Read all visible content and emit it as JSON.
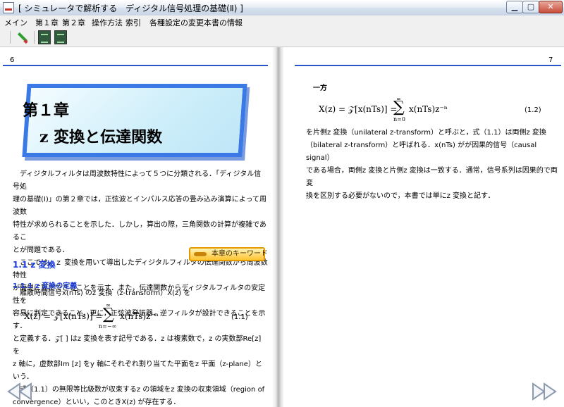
{
  "window": {
    "title": "[ シミュレータで解析する　ディジタル信号処理の基礎(Ⅱ) ]"
  },
  "menu": [
    "メイン",
    "第１章",
    "第２章",
    "操作方法",
    "索引",
    "各種設定の変更",
    "本書の情報"
  ],
  "toolbar": {
    "icons": [
      "pen-icon",
      "screen-icon",
      "screen-icon"
    ]
  },
  "left_page": {
    "page_number": "6",
    "chapter_title": "第１章",
    "chapter_subtitle": "z 変換と伝達関数",
    "intro": [
      "　ディジタルフィルタは周波数特性によって５つに分類される．「ディジタル信号処",
      "理の基礎(Ⅰ)」の第２章では，正弦波とインパルス応答の畳み込み演算によって周波数",
      "特性が求められることを示した．しかし，算出の際，三角関数の計算が複雑であるこ",
      "とが問題である．",
      "　ここでは，ｚ 変換を用いて導出したディジタルフィルタの伝達関数から周波数特性",
      "が簡単に算出できることを示す．また，伝達関数からディジタルフィルタの安定性を",
      "容易に判定できること，更に，正弦波発振器，逆フィルタが設計できることを示す．"
    ],
    "keyword_button": "本章のキーワード",
    "section_heading": "1.1 z 変換",
    "subsection_heading": "1.1.1 z 変換の定義",
    "def_line": "　離散時間信号x(nTs) のz 変換（z-transform）X(z) を",
    "eq1_lhs": "X(z) = 𝒵[x(nTs)] =",
    "eq1_sum_top": "∞",
    "eq1_sum_bottom": "n=−∞",
    "eq1_rhs": "x(nTs)z⁻ⁿ",
    "eq1_number": "(1.1)",
    "after": [
      "と定義する．𝒵[ ] はz 変換を表す記号である．z は複素数で，z の実数部Re[z] を",
      "z 軸に，虚数部Im [z] をy 軸にそれぞれ割り当てた平面をz 平面（z-plane）という．",
      "　式（1.1）の無限等比級数が収束するz の領域をz 変換の収束領域（region of",
      "convergence）といい，このときX(z) が存在する．"
    ]
  },
  "right_page": {
    "page_number": "7",
    "intro_word": "一方",
    "eq2_lhs": "X(z) = 𝒵[x(nTs)] =",
    "eq2_sum_top": "∞",
    "eq2_sum_bottom": "n=0",
    "eq2_rhs": "x(nTs)z⁻ⁿ",
    "eq2_number": "(1.2)",
    "body": [
      "を片側z 変換（unilateral z-transform）と呼ぶと，式（1.1）は両側z 変換",
      "（bilateral z-transform）と呼ばれる．x(nTs) がが因果的信号（causal signal）",
      "である場合，両側z 変換と片側z 変換は一致する．通常，信号系列は因果的で両変",
      "換を区別する必要がないので，本書では単にz 変換と記す．"
    ]
  }
}
